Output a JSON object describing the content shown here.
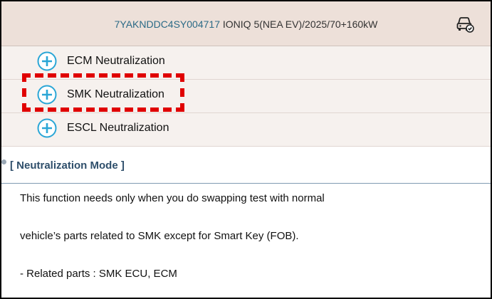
{
  "header": {
    "vin": "7YAKNDDC4SY004717",
    "vehicle": "IONIQ 5(NEA EV)/2025/70+160kW",
    "icon": "car-check-icon"
  },
  "menu": {
    "items": [
      {
        "label": "ECM Neutralization",
        "icon": "plus-circle-icon"
      },
      {
        "label": "SMK Neutralization",
        "icon": "plus-circle-icon",
        "highlighted": true
      },
      {
        "label": "ESCL Neutralization",
        "icon": "plus-circle-icon"
      }
    ]
  },
  "section": {
    "title": "[ Neutralization Mode ]"
  },
  "description": {
    "line1": "This function needs only when you do swapping test with normal",
    "line2": "vehicle’s parts related to SMK except for Smart Key (FOB).",
    "line3": "- Related parts : SMK ECU, ECM"
  },
  "colors": {
    "header_bg": "#ede0d9",
    "menu_bg": "#f6f1ee",
    "accent": "#2aa6d6",
    "highlight": "#e00000",
    "section_title": "#2f4f6b"
  }
}
